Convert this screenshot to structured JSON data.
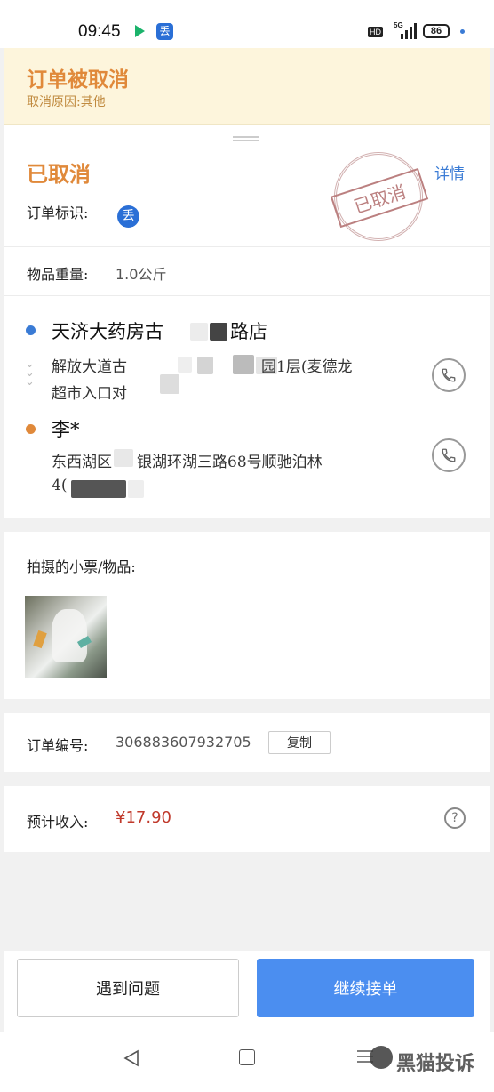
{
  "status_bar": {
    "time": "09:45",
    "battery": "86",
    "hd": "HD",
    "signal": "5G"
  },
  "banner": {
    "title": "订单被取消",
    "reason": "取消原因:其他"
  },
  "order": {
    "status": "已取消",
    "detail_link": "详情",
    "tag_label": "订单标识:",
    "stamp_text": "已取消",
    "weight_label": "物品重量:",
    "weight_value": "1.0公斤"
  },
  "pickup": {
    "name": "天济大药房古",
    "name_suffix": "路店",
    "addr_line1_a": "解放大道古",
    "addr_line1_b": "园1层(麦德龙",
    "addr_line2": "超市入口对"
  },
  "dropoff": {
    "name": "李*",
    "addr_line1_a": "东西湖区",
    "addr_line1_b": "银湖环湖三路68号顺驰泊林",
    "addr_line2": "4("
  },
  "photos": {
    "label": "拍摄的小票/物品:"
  },
  "order_number": {
    "label": "订单编号:",
    "value": "306883607932705",
    "copy_button": "复制"
  },
  "income": {
    "label": "预计收入:",
    "value": "¥17.90",
    "help_icon": "?"
  },
  "footer": {
    "problem_button": "遇到问题",
    "continue_button": "继续接单"
  },
  "watermark": {
    "text": "黑猫投诉"
  },
  "colors": {
    "accent_orange": "#e0893a",
    "link_blue": "#3a7bd5",
    "price_red": "#c0392b",
    "button_blue": "#4b8ef0"
  }
}
